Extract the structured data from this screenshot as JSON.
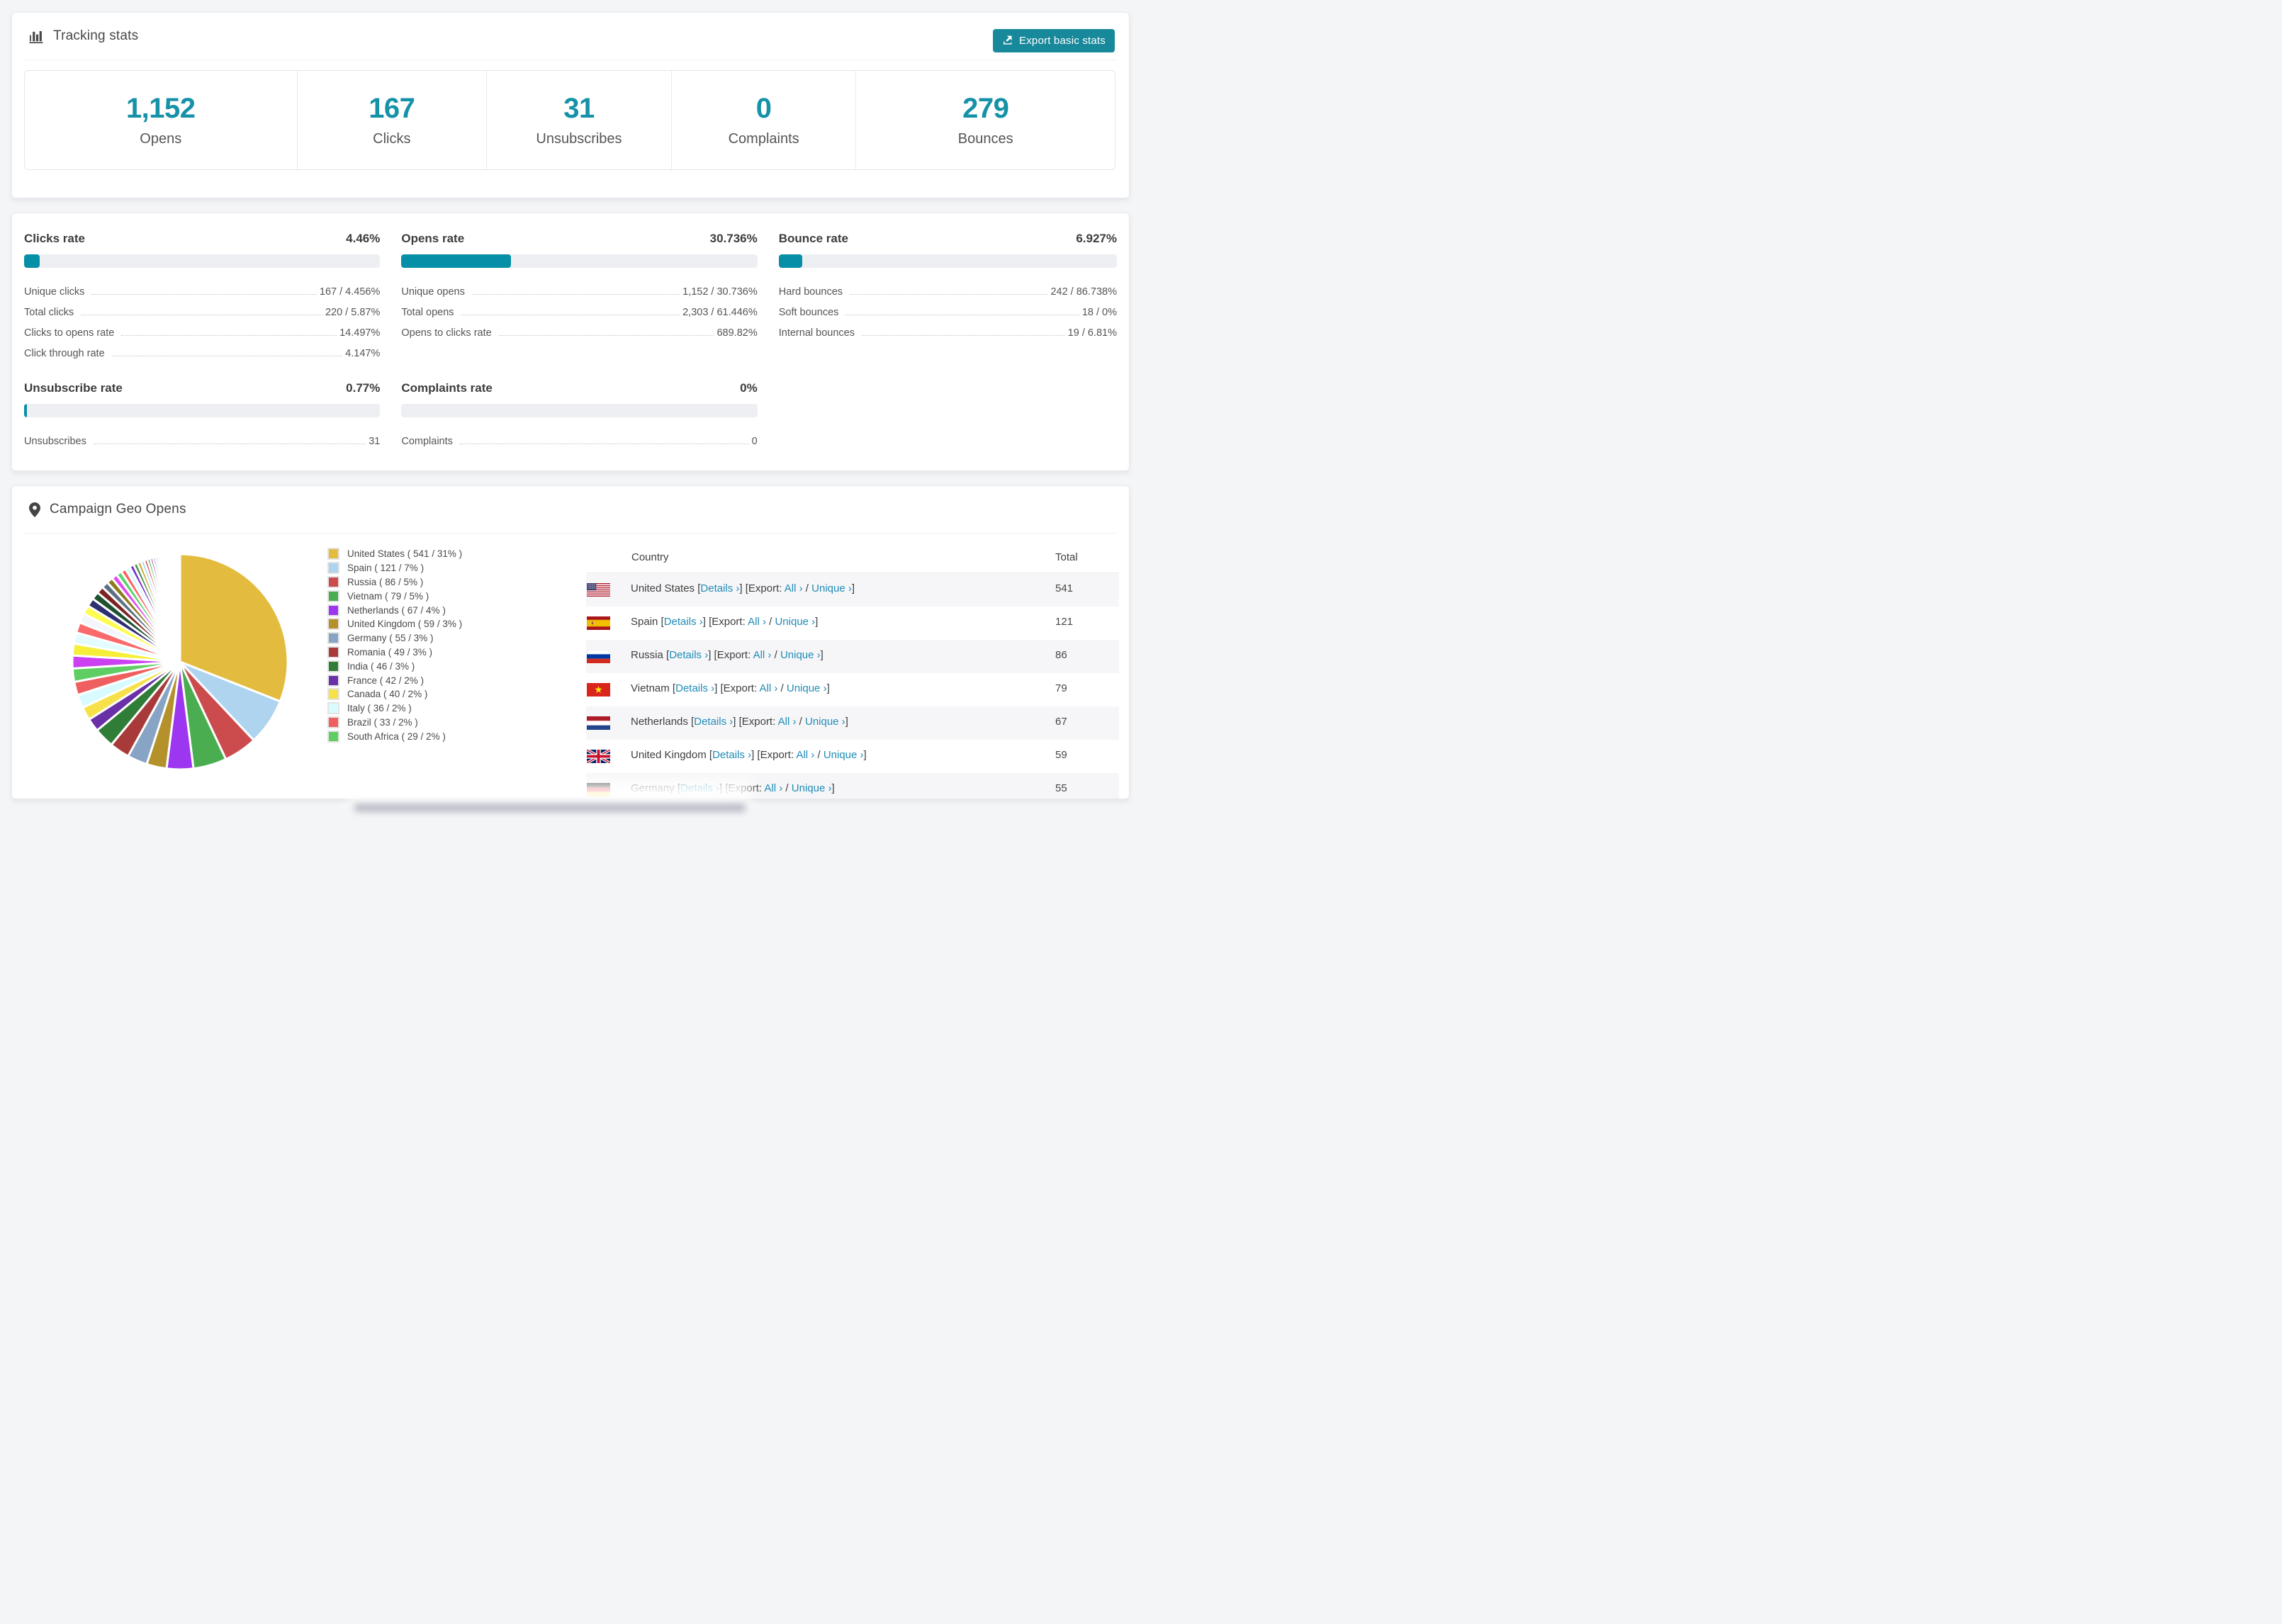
{
  "colors": {
    "accent_button": "#18899b",
    "bar_fill": "#068fa7",
    "stat_number": "#1591a8",
    "link": "#208cb7",
    "bar_track": "#edeff3"
  },
  "header_card": {
    "title": "Tracking stats",
    "export_button_label": "Export basic stats"
  },
  "summary_stats": [
    {
      "value": "1,152",
      "label": "Opens"
    },
    {
      "value": "167",
      "label": "Clicks"
    },
    {
      "value": "31",
      "label": "Unsubscribes"
    },
    {
      "value": "0",
      "label": "Complaints"
    },
    {
      "value": "279",
      "label": "Bounces"
    }
  ],
  "rates": {
    "clicks": {
      "title": "Clicks rate",
      "pct_label": "4.46%",
      "pct": 4.46,
      "rows": [
        {
          "label": "Unique clicks",
          "value": "167 / 4.456%"
        },
        {
          "label": "Total clicks",
          "value": "220 / 5.87%"
        },
        {
          "label": "Clicks to opens rate",
          "value": "14.497%"
        },
        {
          "label": "Click through rate",
          "value": "4.147%"
        }
      ]
    },
    "opens": {
      "title": "Opens rate",
      "pct_label": "30.736%",
      "pct": 30.736,
      "rows": [
        {
          "label": "Unique opens",
          "value": "1,152 / 30.736%"
        },
        {
          "label": "Total opens",
          "value": "2,303 / 61.446%"
        },
        {
          "label": "Opens to clicks rate",
          "value": "689.82%"
        }
      ]
    },
    "bounce": {
      "title": "Bounce rate",
      "pct_label": "6.927%",
      "pct": 6.927,
      "rows": [
        {
          "label": "Hard bounces",
          "value": "242 / 86.738%"
        },
        {
          "label": "Soft bounces",
          "value": "18 / 0%"
        },
        {
          "label": "Internal bounces",
          "value": "19 / 6.81%"
        }
      ]
    },
    "unsubscribe": {
      "title": "Unsubscribe rate",
      "pct_label": "0.77%",
      "pct": 0.77,
      "rows": [
        {
          "label": "Unsubscribes",
          "value": "31"
        }
      ]
    },
    "complaints": {
      "title": "Complaints rate",
      "pct_label": "0%",
      "pct": 0,
      "rows": [
        {
          "label": "Complaints",
          "value": "0"
        }
      ]
    }
  },
  "geo": {
    "title": "Campaign Geo Opens",
    "link_parts": {
      "details": "Details",
      "export_prefix": "Export:",
      "all": "All",
      "unique": "Unique",
      "chevron": "›"
    },
    "table": {
      "columns": [
        "Country",
        "Total"
      ],
      "rows": [
        {
          "country": "United States",
          "flag": "us",
          "total": "541"
        },
        {
          "country": "Spain",
          "flag": "es",
          "total": "121"
        },
        {
          "country": "Russia",
          "flag": "ru",
          "total": "86"
        },
        {
          "country": "Vietnam",
          "flag": "vn",
          "total": "79"
        },
        {
          "country": "Netherlands",
          "flag": "nl",
          "total": "67"
        },
        {
          "country": "United Kingdom",
          "flag": "gb",
          "total": "59"
        },
        {
          "country": "Germany",
          "flag": "de",
          "total": "55"
        }
      ]
    }
  },
  "chart_data": {
    "type": "pie",
    "title": "Campaign Geo Opens",
    "legend_position": "right",
    "start_angle_deg": -90,
    "direction": "clockwise",
    "slices": [
      {
        "label": "United States",
        "count": 541,
        "pct": 31,
        "color": "#e3bc3f"
      },
      {
        "label": "Spain",
        "count": 121,
        "pct": 7,
        "color": "#aed4f0"
      },
      {
        "label": "Russia",
        "count": 86,
        "pct": 5,
        "color": "#cc4c4e"
      },
      {
        "label": "Vietnam",
        "count": 79,
        "pct": 5,
        "color": "#4aae51"
      },
      {
        "label": "Netherlands",
        "count": 67,
        "pct": 4,
        "color": "#9c36f0"
      },
      {
        "label": "United Kingdom",
        "count": 59,
        "pct": 3,
        "color": "#b5912c"
      },
      {
        "label": "Germany",
        "count": 55,
        "pct": 3,
        "color": "#88a4c4"
      },
      {
        "label": "Romania",
        "count": 49,
        "pct": 3,
        "color": "#a93a3a"
      },
      {
        "label": "India",
        "count": 46,
        "pct": 3,
        "color": "#2f7d36"
      },
      {
        "label": "France",
        "count": 42,
        "pct": 2,
        "color": "#6930a8"
      },
      {
        "label": "Canada",
        "count": 40,
        "pct": 2,
        "color": "#f7e14b"
      },
      {
        "label": "Italy",
        "count": 36,
        "pct": 2,
        "color": "#d8fbff"
      },
      {
        "label": "Brazil",
        "count": 33,
        "pct": 2,
        "color": "#ef5f5f"
      },
      {
        "label": "South Africa",
        "count": 29,
        "pct": 2,
        "color": "#5fce62"
      }
    ],
    "others_total_pct": 26,
    "others_slice_count": 40,
    "others_palette": [
      "#cb41f2",
      "#f6ef3a",
      "#e2fcff",
      "#fa6a6a",
      "#f4f6ff",
      "#fdfd4f",
      "#2e2f72",
      "#1e5230",
      "#7d2323",
      "#5d7184",
      "#8d7c1f",
      "#e04cf0",
      "#5ad46c",
      "#ff6060",
      "#daf7ff",
      "#7a33c4",
      "#3f8f46",
      "#c9a42c",
      "#a8d4f0",
      "#d44747",
      "#44bb55",
      "#b23a8f",
      "#7577cc",
      "#38b2a5"
    ]
  }
}
